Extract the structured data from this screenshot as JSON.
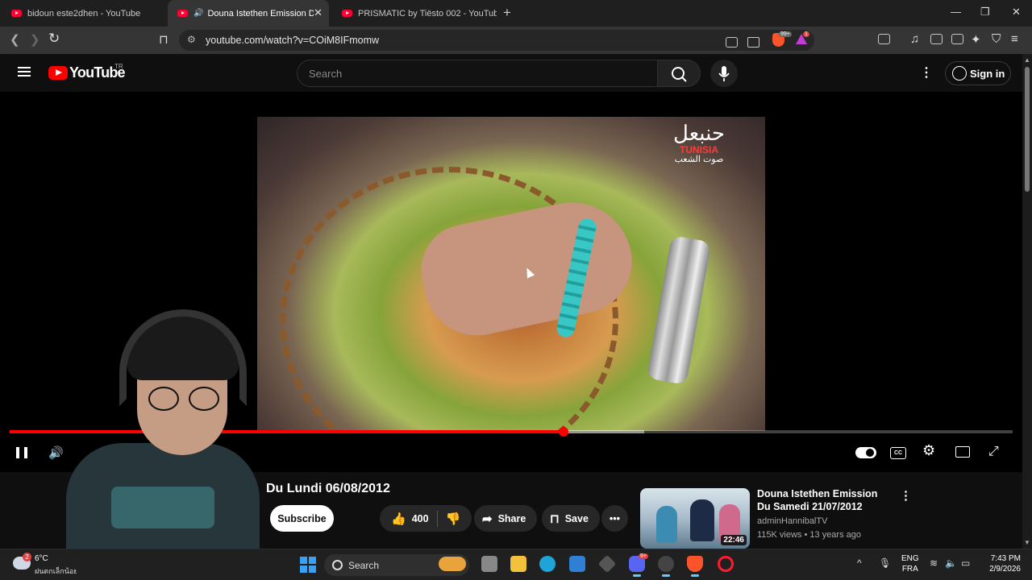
{
  "browser": {
    "tabs": [
      {
        "title": "bidoun este2dhen - YouTube",
        "active": false
      },
      {
        "title": "Douna Istethen Emission Du l",
        "active": true
      },
      {
        "title": "PRISMATIC by Tiësto 002 - YouTube",
        "active": false
      }
    ],
    "url": "youtube.com/watch?v=COiM8IFmomw",
    "extension_badge": "99+",
    "alert_badge": "1"
  },
  "youtube": {
    "logo_text": "YouTube",
    "country_code": "TR",
    "search_placeholder": "Search",
    "sign_in": "Sign in"
  },
  "player": {
    "watermark_line1": "حنبعل",
    "watermark_line2": "TUNISIA",
    "watermark_line3": "صوت الشعب",
    "progress_fraction": 0.552,
    "buffered_fraction": 0.633,
    "captions_label": "CC"
  },
  "video": {
    "title": "Du Lundi 06/08/2012",
    "subscribe": "Subscribe",
    "likes": "400",
    "share": "Share",
    "save": "Save"
  },
  "recommended": [
    {
      "title": "Douna Istethen Emission Du Samedi 21/07/2012",
      "channel": "adminHannibalTV",
      "meta": "115K views • 13 years ago",
      "duration": "22:46"
    }
  ],
  "taskbar": {
    "weather_temp": "6°C",
    "weather_desc": "ฝนตกเล็กน้อย",
    "weather_badge": "2",
    "search_label": "Search",
    "discord_badge": "9+",
    "lang_line1": "ENG",
    "lang_line2": "FRA",
    "time": "7:43 PM",
    "date": "2/9/2026"
  },
  "colors": {
    "youtube_red": "#ff0000",
    "accent_blue": "#3aa0f3"
  }
}
